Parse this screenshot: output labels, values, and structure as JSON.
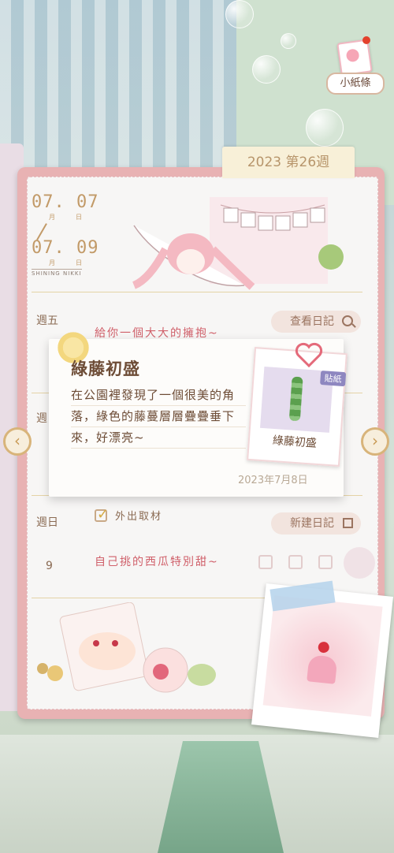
{
  "hud": {
    "note_label": "小紙條"
  },
  "diary": {
    "week_tab": "2023 第26週",
    "date_start": "07. 07",
    "date_end": "07. 09",
    "month_label": "月",
    "day_label": "日",
    "brand": "SHINING NIKKI",
    "entries": [
      {
        "day": "週五",
        "text": "給你一個大大的擁抱~",
        "button": "查看日記"
      },
      {
        "day": "週",
        "text": "",
        "button": ""
      },
      {
        "day": "週日",
        "todo": "外出取材",
        "num": "9",
        "text": "自己挑的西瓜特別甜~",
        "button": "新建日記"
      }
    ]
  },
  "popup": {
    "title": "綠藤初盛",
    "body": "在公園裡發現了一個很美的角落，綠色的藤蔓層層疊疊垂下來，好漂亮~",
    "date": "2023年7月8日",
    "sticker_badge": "貼紙",
    "sticker_name": "綠藤初盛"
  },
  "nav": {
    "prev": "‹",
    "next": "›"
  },
  "colors": {
    "accent": "#c29a68",
    "pink_frame": "#e8b2b3",
    "entry_text": "#d0606a"
  }
}
